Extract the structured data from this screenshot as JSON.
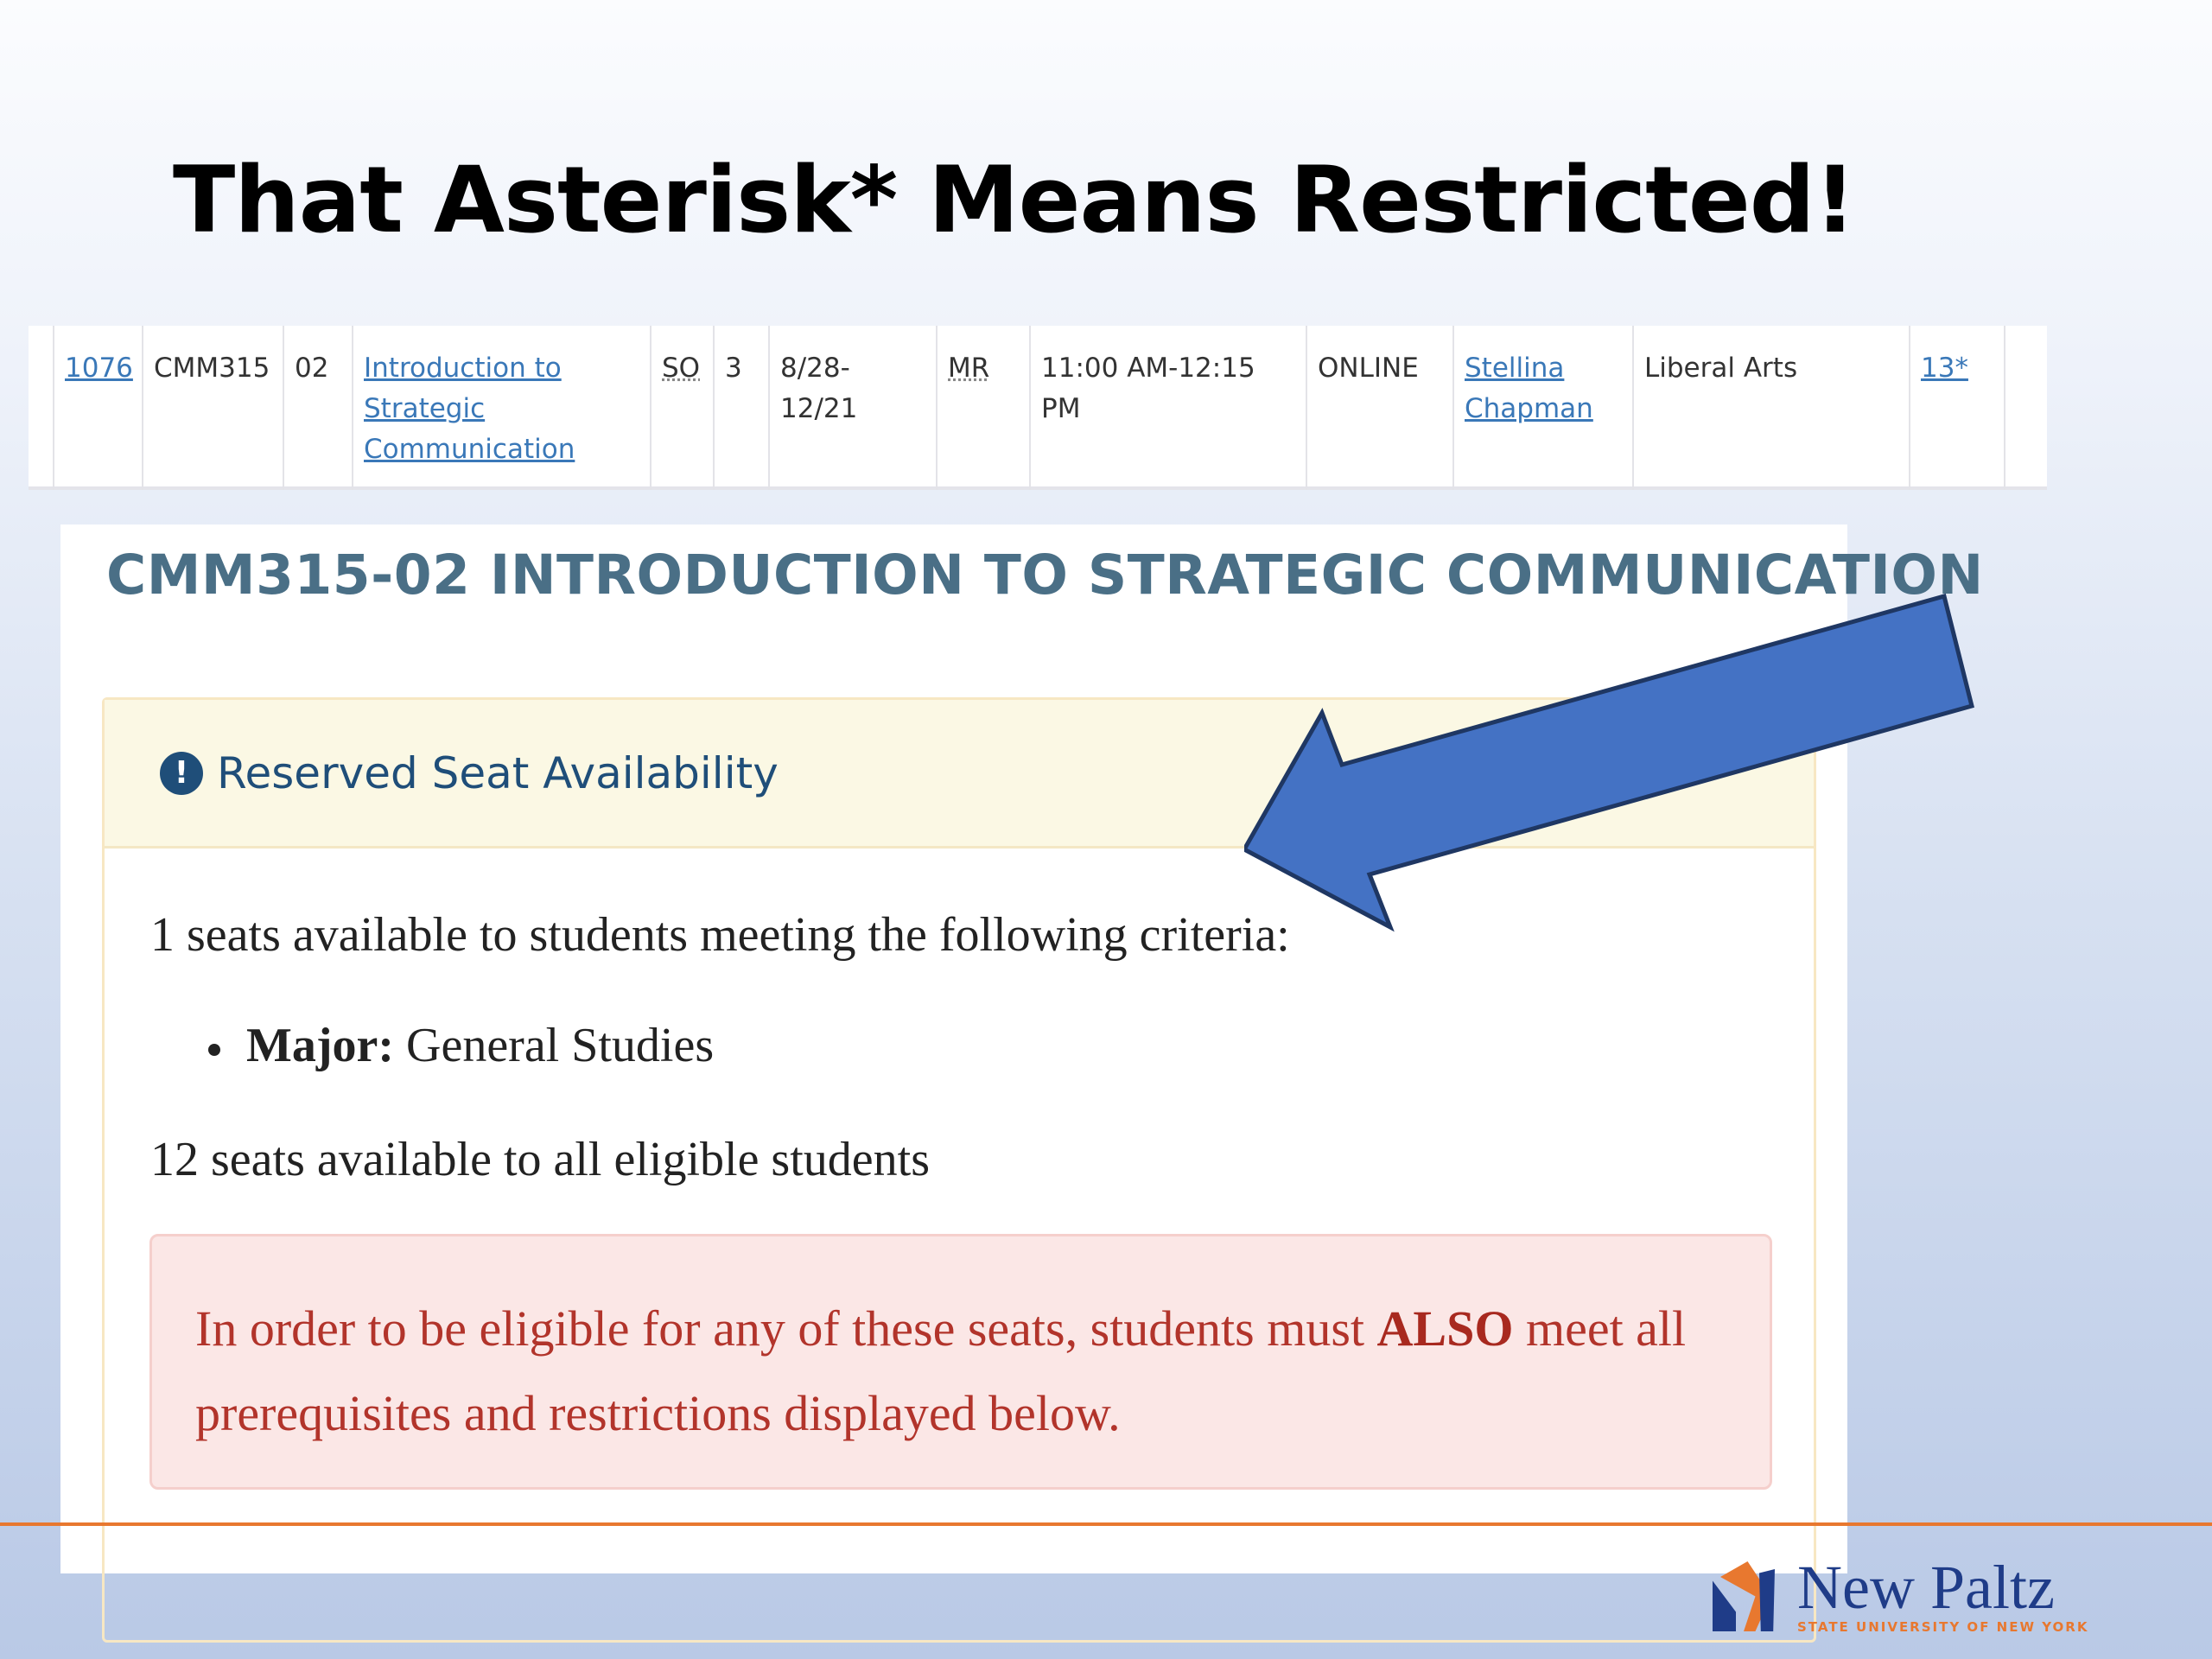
{
  "slide": {
    "title": "That Asterisk* Means Restricted!"
  },
  "course_row": {
    "crn": "1076",
    "course": "CMM315",
    "section": "02",
    "title_line1": "Introduction to",
    "title_line2": "Strategic",
    "title_line3": "Communication",
    "level": "SO",
    "credits": "3",
    "dates": "8/28-12/21",
    "days": "MR",
    "time": "11:00 AM-12:15 PM",
    "location": "ONLINE",
    "instructor_line1": "Stellina",
    "instructor_line2": "Chapman",
    "category": "Liberal Arts",
    "seats": "13*"
  },
  "detail": {
    "heading": "CMM315-02 INTRODUCTION TO STRATEGIC COMMUNICATION",
    "reserved_title": "Reserved Seat Availability",
    "info_icon_glyph": "!",
    "criteria_text": "1 seats available to students meeting the following criteria:",
    "criteria": [
      {
        "label": "Major:",
        "value": "General Studies"
      }
    ],
    "general_text": "12 seats available to all eligible students",
    "alert_pre": "In order to be eligible for any of these seats, students must ",
    "alert_strong": "ALSO",
    "alert_post": " meet all prerequisites and restrictions displayed below."
  },
  "logo": {
    "name": "New Paltz",
    "subtitle": "STATE UNIVERSITY OF NEW YORK"
  },
  "colors": {
    "arrow": "#4472c4",
    "heading": "#4a6f86",
    "link": "#3a78b8",
    "alert_text": "#b2342b",
    "accent_orange": "#e8782f"
  }
}
